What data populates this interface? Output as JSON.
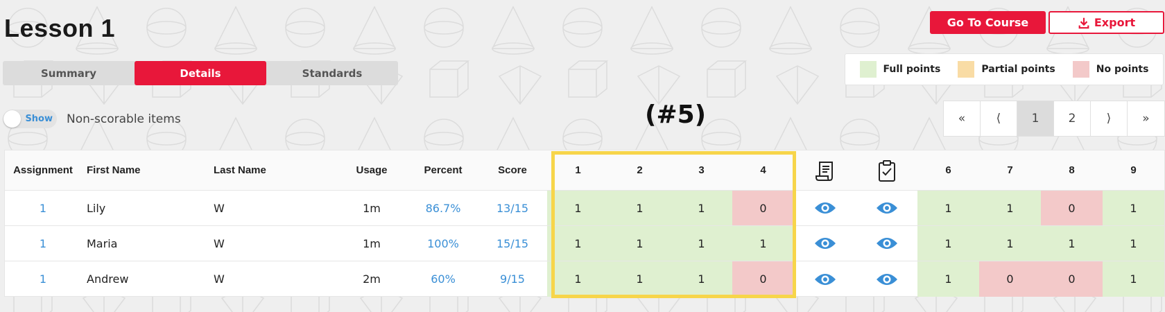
{
  "page": {
    "title": "Lesson 1"
  },
  "actions": {
    "go_to_course": "Go To Course",
    "export": "Export"
  },
  "tabs": [
    {
      "label": "Summary",
      "active": false
    },
    {
      "label": "Details",
      "active": true
    },
    {
      "label": "Standards",
      "active": false
    }
  ],
  "legend": [
    {
      "label": "Full points",
      "color": "#dff0d0"
    },
    {
      "label": "Partial points",
      "color": "#f9dca5"
    },
    {
      "label": "No points",
      "color": "#f3c9c9"
    }
  ],
  "toggle": {
    "state_label": "Show",
    "label": "Non-scorable items"
  },
  "annotation": "(#5)",
  "pagination": {
    "first": "«",
    "prev": "⟨",
    "pages": [
      "1",
      "2"
    ],
    "active_page": "1",
    "next": "⟩",
    "last": "»"
  },
  "table": {
    "headers": {
      "assignment": "Assignment",
      "first_name": "First Name",
      "last_name": "Last Name",
      "usage": "Usage",
      "percent": "Percent",
      "score": "Score",
      "items": [
        "1",
        "2",
        "3",
        "4",
        "document-icon",
        "clipboard-check-icon",
        "6",
        "7",
        "8",
        "9"
      ]
    },
    "rows": [
      {
        "assignment": "1",
        "first_name": "Lily",
        "last_name": "W",
        "usage": "1m",
        "percent": "86.7%",
        "score": "13/15",
        "items": [
          "1",
          "1",
          "1",
          "0",
          "eye-icon",
          "eye-icon",
          "1",
          "1",
          "0",
          "1"
        ]
      },
      {
        "assignment": "1",
        "first_name": "Maria",
        "last_name": "W",
        "usage": "1m",
        "percent": "100%",
        "score": "15/15",
        "items": [
          "1",
          "1",
          "1",
          "1",
          "eye-icon",
          "eye-icon",
          "1",
          "1",
          "1",
          "1"
        ]
      },
      {
        "assignment": "1",
        "first_name": "Andrew",
        "last_name": "W",
        "usage": "2m",
        "percent": "60%",
        "score": "9/15",
        "items": [
          "1",
          "1",
          "1",
          "0",
          "eye-icon",
          "eye-icon",
          "1",
          "0",
          "0",
          "1"
        ]
      }
    ]
  },
  "colors": {
    "accent": "#e8173a",
    "link": "#3a8fd6",
    "highlight": "#f7d54a"
  }
}
